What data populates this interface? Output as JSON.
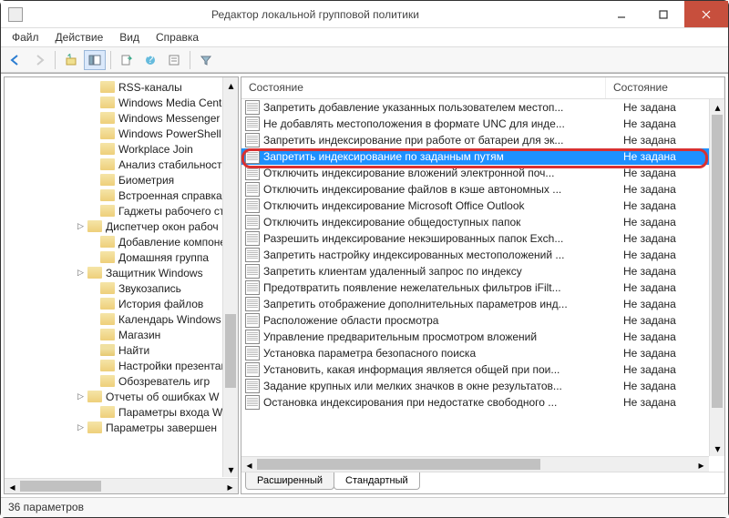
{
  "window": {
    "title": "Редактор локальной групповой политики"
  },
  "menu": [
    "Файл",
    "Действие",
    "Вид",
    "Справка"
  ],
  "tree": {
    "items": [
      {
        "label": "RSS-каналы",
        "expandable": false,
        "open": false,
        "indent": 88
      },
      {
        "label": "Windows Media Center",
        "expandable": false,
        "open": false,
        "indent": 88
      },
      {
        "label": "Windows Messenger",
        "expandable": false,
        "open": false,
        "indent": 88
      },
      {
        "label": "Windows PowerShell",
        "expandable": false,
        "open": false,
        "indent": 88
      },
      {
        "label": "Workplace Join",
        "expandable": false,
        "open": false,
        "indent": 88
      },
      {
        "label": "Анализ стабильности т",
        "expandable": false,
        "open": false,
        "indent": 88
      },
      {
        "label": "Биометрия",
        "expandable": false,
        "open": false,
        "indent": 88
      },
      {
        "label": "Встроенная справка",
        "expandable": false,
        "open": false,
        "indent": 88
      },
      {
        "label": "Гаджеты рабочего сто",
        "expandable": false,
        "open": false,
        "indent": 88
      },
      {
        "label": "Диспетчер окон рабоч",
        "expandable": true,
        "open": false,
        "indent": 74
      },
      {
        "label": "Добавление компонен",
        "expandable": false,
        "open": false,
        "indent": 88
      },
      {
        "label": "Домашняя группа",
        "expandable": false,
        "open": false,
        "indent": 88
      },
      {
        "label": "Защитник Windows",
        "expandable": true,
        "open": false,
        "indent": 74
      },
      {
        "label": "Звукозапись",
        "expandable": false,
        "open": false,
        "indent": 88
      },
      {
        "label": "История файлов",
        "expandable": false,
        "open": false,
        "indent": 88
      },
      {
        "label": "Календарь Windows",
        "expandable": false,
        "open": false,
        "indent": 88
      },
      {
        "label": "Магазин",
        "expandable": false,
        "open": false,
        "indent": 88
      },
      {
        "label": "Найти",
        "expandable": false,
        "open": true,
        "indent": 88
      },
      {
        "label": "Настройки презентаци",
        "expandable": false,
        "open": false,
        "indent": 88
      },
      {
        "label": "Обозреватель игр",
        "expandable": false,
        "open": false,
        "indent": 88
      },
      {
        "label": "Отчеты об ошибках W",
        "expandable": true,
        "open": false,
        "indent": 74
      },
      {
        "label": "Параметры входа Winс",
        "expandable": false,
        "open": false,
        "indent": 88
      },
      {
        "label": "Параметры завершен",
        "expandable": true,
        "open": false,
        "indent": 74
      }
    ]
  },
  "list": {
    "col1": "Состояние",
    "col2": "Состояние",
    "rows": [
      {
        "name": "Запретить добавление указанных пользователем местоп...",
        "state": "Не задана",
        "sel": false
      },
      {
        "name": "Не добавлять местоположения в формате UNC для инде...",
        "state": "Не задана",
        "sel": false
      },
      {
        "name": "Запретить индексирование при работе от батареи для эк...",
        "state": "Не задана",
        "sel": false
      },
      {
        "name": "Запретить индексирование по заданным путям",
        "state": "Не задана",
        "sel": true
      },
      {
        "name": "Отключить индексирование вложений электронной поч...",
        "state": "Не задана",
        "sel": false
      },
      {
        "name": "Отключить индексирование файлов в кэше автономных ...",
        "state": "Не задана",
        "sel": false
      },
      {
        "name": "Отключить индексирование Microsoft Office Outlook",
        "state": "Не задана",
        "sel": false
      },
      {
        "name": "Отключить индексирование общедоступных папок",
        "state": "Не задана",
        "sel": false
      },
      {
        "name": "Разрешить индексирование некэшированных папок Exch...",
        "state": "Не задана",
        "sel": false
      },
      {
        "name": "Запретить настройку индексированных местоположений ...",
        "state": "Не задана",
        "sel": false
      },
      {
        "name": "Запретить клиентам удаленный запрос по индексу",
        "state": "Не задана",
        "sel": false
      },
      {
        "name": "Предотвратить появление нежелательных фильтров iFilt...",
        "state": "Не задана",
        "sel": false
      },
      {
        "name": "Запретить отображение дополнительных параметров инд...",
        "state": "Не задана",
        "sel": false
      },
      {
        "name": "Расположение области просмотра",
        "state": "Не задана",
        "sel": false
      },
      {
        "name": "Управление предварительным просмотром вложений",
        "state": "Не задана",
        "sel": false
      },
      {
        "name": "Установка параметра безопасного поиска",
        "state": "Не задана",
        "sel": false
      },
      {
        "name": "Установить, какая информация является общей при пои...",
        "state": "Не задана",
        "sel": false
      },
      {
        "name": "Задание крупных или мелких значков в окне результатов...",
        "state": "Не задана",
        "sel": false
      },
      {
        "name": "Остановка индексирования при недостатке свободного ...",
        "state": "Не задана",
        "sel": false
      }
    ]
  },
  "tabs": [
    "Расширенный",
    "Стандартный"
  ],
  "status": "36 параметров"
}
